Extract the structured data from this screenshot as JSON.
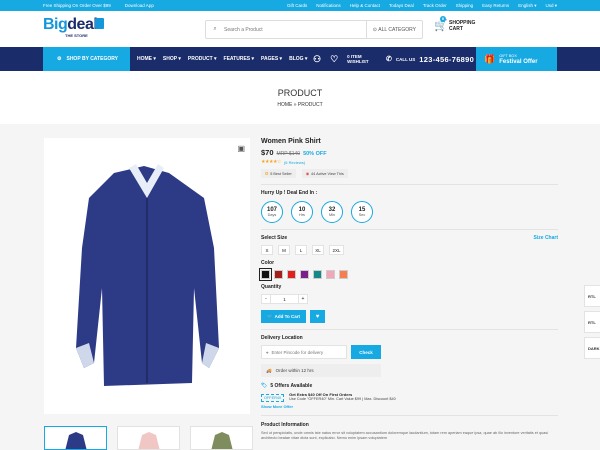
{
  "topbar": {
    "shipping": "Free Shipping On Order Over $99",
    "download": "Download App",
    "links": [
      "Gift Cards",
      "Notifications",
      "Help & Contact",
      "Todays Deal",
      "Track Order",
      "Shipping",
      "Easy Returns"
    ],
    "language": "English",
    "currency": "Usd"
  },
  "logo": {
    "part1": "Big",
    "part2": "deal",
    "tagline": "THE STORE"
  },
  "search": {
    "placeholder": "Search a Product",
    "category": "ALL CATEGORY"
  },
  "cart": {
    "label1": "SHOPPING",
    "label2": "CART",
    "count": "0"
  },
  "nav": {
    "shop_by_category": "SHOP BY CATEGORY",
    "menu": [
      "HOME",
      "SHOP",
      "PRODUCT",
      "FEATURES",
      "PAGES",
      "BLOG"
    ],
    "wishlist_count": "0 ITEM",
    "wishlist_label": "WISHLIST",
    "call_label": "CALL US",
    "phone": "123-456-76890",
    "gift_small": "GIFT BOX",
    "gift_big": "Festival Offer"
  },
  "banner": {
    "title": "PRODUCT",
    "crumb_home": "HOME",
    "crumb_sep": "»",
    "crumb_current": "PRODUCT"
  },
  "product": {
    "name": "Women Pink Shirt",
    "price": "$70",
    "mrp": "MRP $140",
    "off": "50% OFF",
    "stars": "★★★★☆",
    "reviews": "(6 Reviews)",
    "badge1": "5 Best Seller",
    "badge2": "44 Active View This",
    "deal_label": "Hurry Up ! Deal End In :",
    "timer": [
      {
        "n": "107",
        "u": "Days"
      },
      {
        "n": "10",
        "u": "Hrs"
      },
      {
        "n": "32",
        "u": "Min"
      },
      {
        "n": "15",
        "u": "Sec"
      }
    ],
    "size_label": "Select Size",
    "size_chart": "Size Chart",
    "sizes": [
      "S",
      "M",
      "L",
      "XL",
      "2XL"
    ],
    "color_label": "Color",
    "colors": [
      "#111111",
      "#a1201b",
      "#e01f1f",
      "#7b1d8a",
      "#15898a",
      "#f2a6b9",
      "#f57f4e"
    ],
    "qty_label": "Quantity",
    "qty_minus": "-",
    "qty_value": "1",
    "qty_plus": "+",
    "add_to_cart": "Add To Cart",
    "delivery_label": "Delivery Location",
    "pincode_placeholder": "Enter Pincode for delivery",
    "check": "Check",
    "order_within": "Order within 12 hrs",
    "offers_title": "5 Offers Available",
    "offer_code": "OFFER40",
    "offer_title": "Get Extra $40 Off On First Orders",
    "offer_desc": "Use Code \"OFFER40\" Min. Cart Value $99 | Max. Discount $40",
    "show_more": "Show More Offer",
    "info_label": "Product Information",
    "info_text": "Sed ut perspiciatis, unde omnis iste natus error sit voluptatem accusantium doloremque laudantium, totam rem aperiam eaque ipsa, quae ab illo inventore veritatis et quasi architecto beatae vitae dicta sunt, explicabo. Nemo enim ipsam voluptatem"
  },
  "side": [
    "RTL",
    "RTL",
    "DARK"
  ]
}
